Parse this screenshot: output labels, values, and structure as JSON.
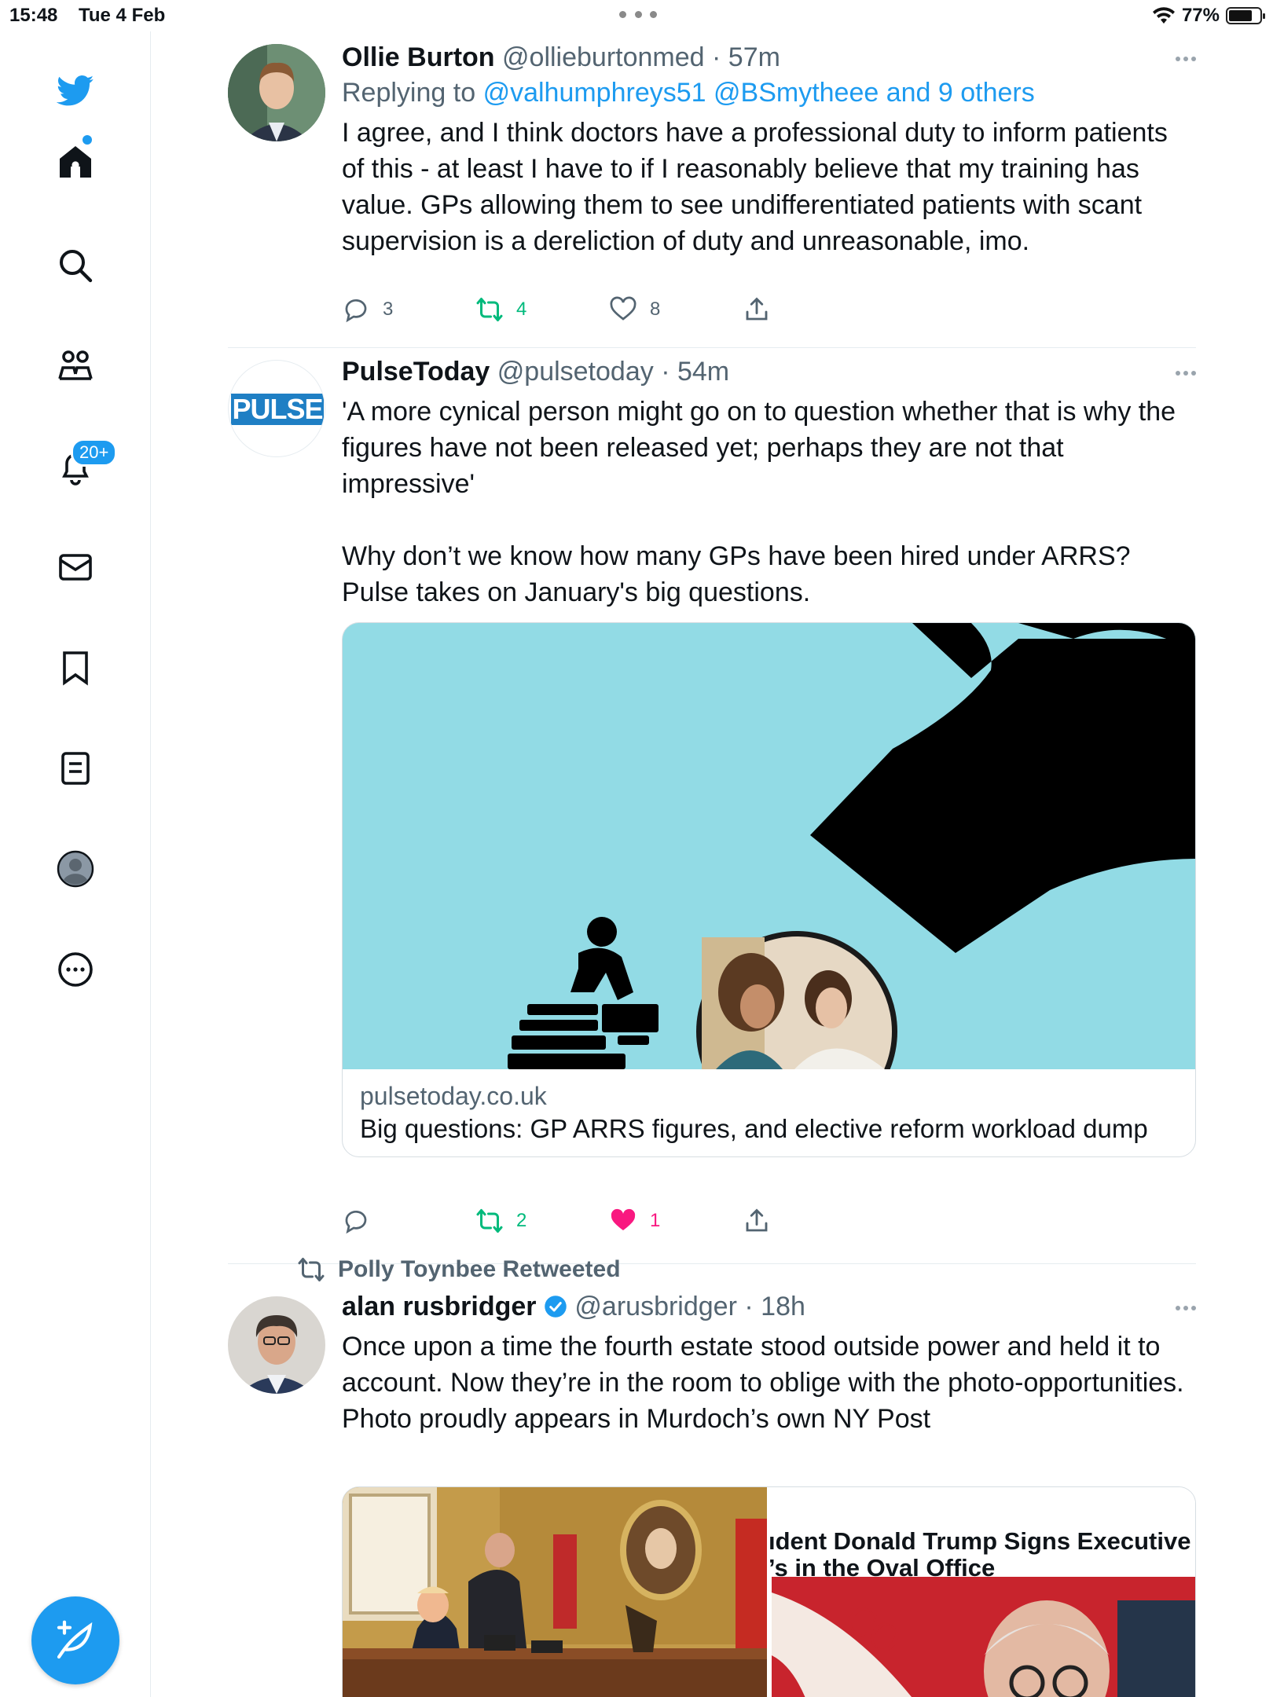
{
  "status_bar": {
    "time": "15:48",
    "date": "Tue 4 Feb",
    "battery": "77%",
    "battery_level": 0.77
  },
  "sidebar": {
    "items": [
      {
        "icon": "twitter-logo-icon"
      },
      {
        "icon": "home-icon"
      },
      {
        "icon": "search-icon"
      },
      {
        "icon": "communities-icon"
      },
      {
        "icon": "notifications-bell-icon"
      },
      {
        "icon": "messages-envelope-icon"
      },
      {
        "icon": "bookmark-icon"
      },
      {
        "icon": "lists-icon"
      },
      {
        "icon": "profile-avatar-icon"
      },
      {
        "icon": "more-circle-icon"
      }
    ],
    "notifications_badge": "20+",
    "compose_icon": "compose-feather-icon"
  },
  "colors": {
    "accent": "#1d9bf0",
    "retweet_green": "#00ba7c",
    "like_pink": "#f91880",
    "muted": "#536471",
    "card_bg": "#92dbe5"
  },
  "tweets": [
    {
      "name": "Ollie Burton",
      "handle": "@ollieburtonmed",
      "time": "57m",
      "replying_prefix": "Replying to",
      "replying_links": "@valhumphreys51 @BSmytheee and 9 others",
      "text": "I agree, and I think doctors have a professional duty to inform patients of this - at least I have to if I reasonably believe that my training has value. GPs allowing them to see undifferentiated patients with scant supervision is a dereliction of duty and unreasonable, imo.",
      "replies": "3",
      "retweets": "4",
      "likes": "8"
    },
    {
      "name": "PulseToday",
      "handle": "@pulsetoday",
      "time": "54m",
      "avatar_text": "PULSE",
      "text": "'A more cynical person might go on to question whether that is why the figures have not been released yet; perhaps they are not that impressive'\n\nWhy don’t we know how many GPs have been hired under ARRS? Pulse takes on January's big questions.",
      "card_domain": "pulsetoday.co.uk",
      "card_title": "Big questions: GP ARRS figures, and elective reform workload dump",
      "replies": "",
      "retweets": "2",
      "likes": "1"
    },
    {
      "retweeted_by": "Polly Toynbee Retweeted",
      "name": "alan rusbridger",
      "handle": "@arusbridger",
      "time": "18h",
      "verified": true,
      "text": "Once upon a time the fourth estate stood outside power and held it to account. Now they’re in the room to oblige with the photo-opportunities. Photo proudly appears in Murdoch’s own NY Post",
      "media_headline": "ıdent Donald Trump Signs Executive\n’s in the Oval Office"
    }
  ]
}
